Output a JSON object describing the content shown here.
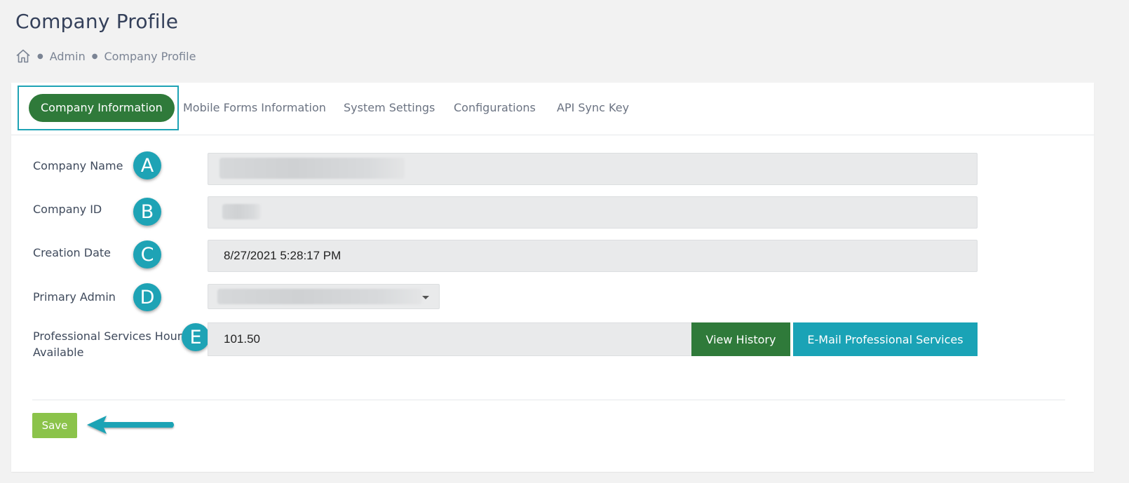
{
  "page": {
    "title": "Company Profile"
  },
  "breadcrumb": {
    "home_icon": "home-icon",
    "items": [
      "Admin",
      "Company Profile"
    ]
  },
  "tabs": [
    {
      "label": "Company Information",
      "active": true
    },
    {
      "label": "Mobile Forms Information",
      "active": false
    },
    {
      "label": "System Settings",
      "active": false
    },
    {
      "label": "Configurations",
      "active": false
    },
    {
      "label": "API Sync Key",
      "active": false
    }
  ],
  "form": {
    "company_name": {
      "label": "Company Name",
      "badge": "A",
      "value": ""
    },
    "company_id": {
      "label": "Company ID",
      "badge": "B",
      "value": ""
    },
    "creation_date": {
      "label": "Creation Date",
      "badge": "C",
      "value": "8/27/2021 5:28:17 PM"
    },
    "primary_admin": {
      "label": "Primary Admin",
      "badge": "D",
      "value": ""
    },
    "ps_hours": {
      "label_line1": "Professional Services Hours",
      "label_line2": "Available",
      "badge": "E",
      "value": "101.50",
      "view_history_label": "View History",
      "email_label": "E-Mail Professional Services"
    }
  },
  "footer": {
    "save_label": "Save"
  },
  "colors": {
    "accent_teal": "#1ea3b5",
    "active_tab_green": "#2f7a3a",
    "save_green": "#8bc34a"
  }
}
